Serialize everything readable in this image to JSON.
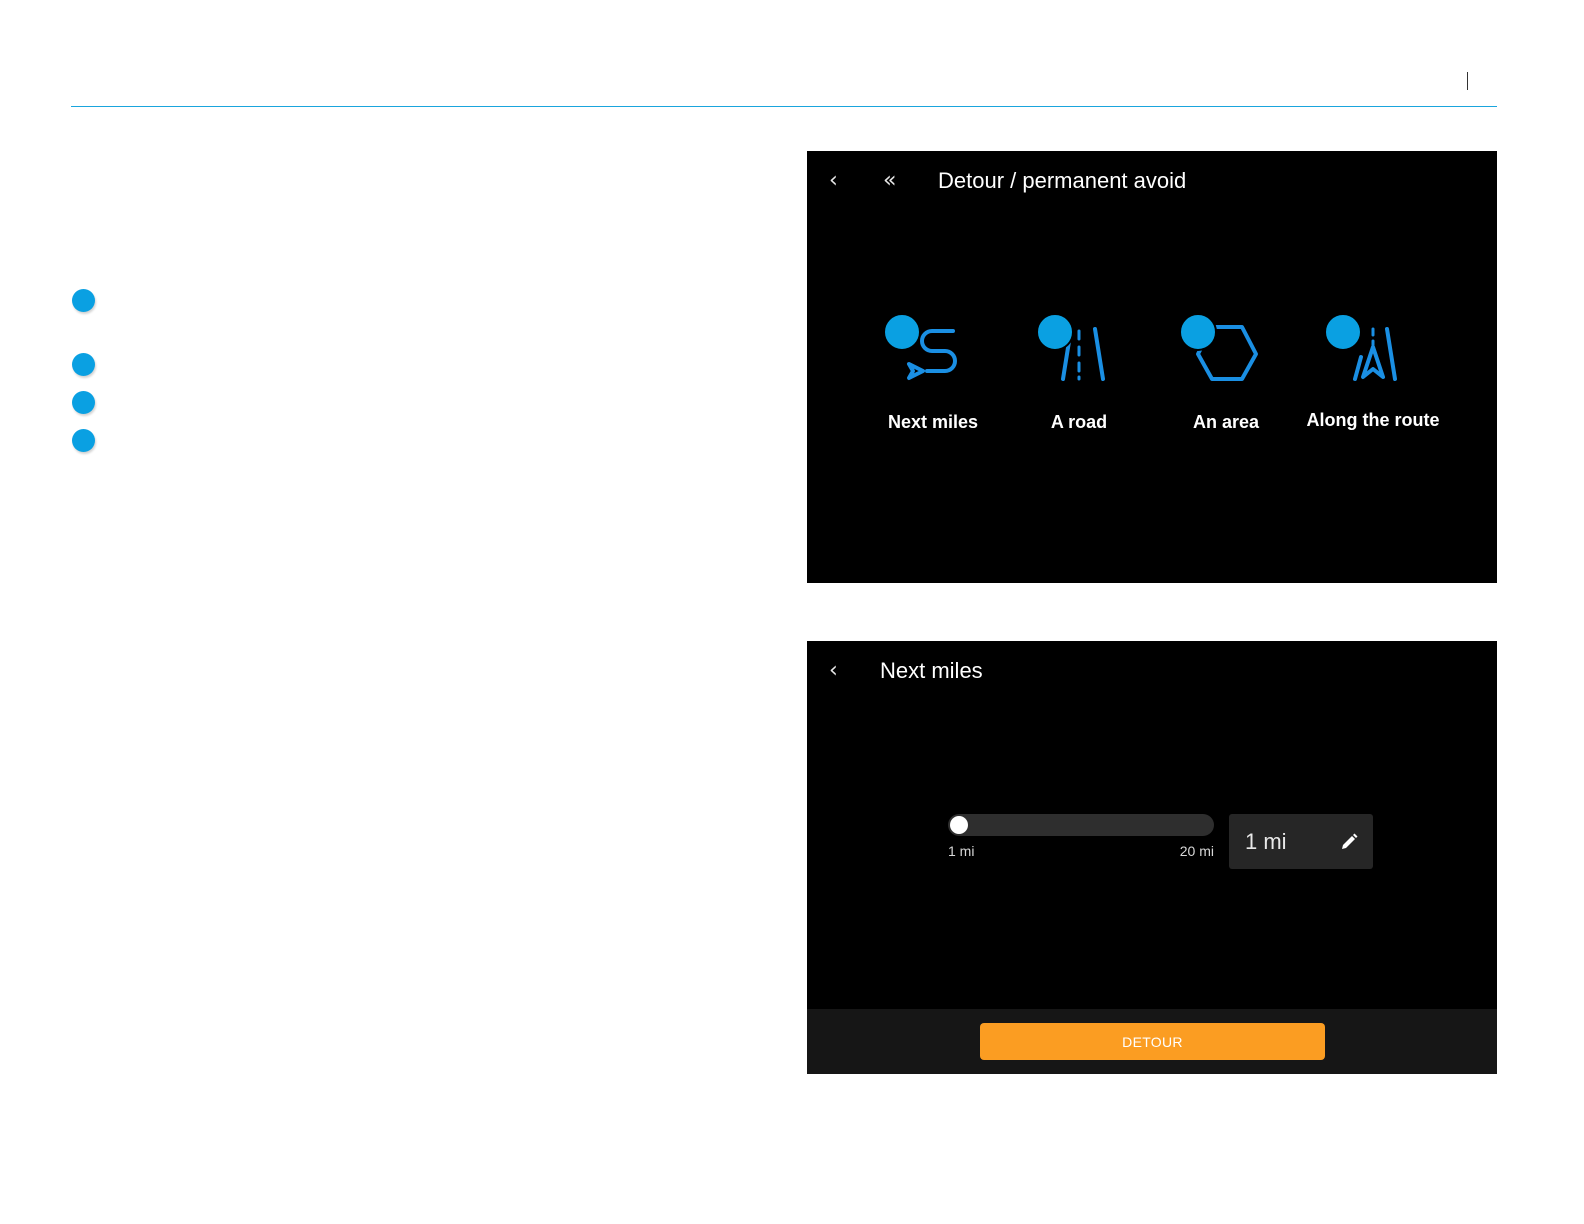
{
  "theme": {
    "accent": "#0aa0e2",
    "header_rule": "#1aa5dd",
    "screen_bg": "#000000",
    "icon_stroke": "#1a8fe3",
    "button_bg": "#fb9d22",
    "field_bg": "#262626",
    "bar_bg": "#161616"
  },
  "bullets": [
    "bullet",
    "bullet",
    "bullet",
    "bullet"
  ],
  "screen1": {
    "back_icon": "back-chevron-icon",
    "home_icon": "double-chevron-icon",
    "title": "Detour / permanent avoid",
    "options": [
      {
        "label": "Next miles",
        "icon": "route-return-icon"
      },
      {
        "label": "A road",
        "icon": "road-lanes-icon"
      },
      {
        "label": "An area",
        "icon": "hexagon-area-icon"
      },
      {
        "label": "Along the route",
        "icon": "route-arrow-icon"
      }
    ]
  },
  "screen2": {
    "back_icon": "back-chevron-icon",
    "title": "Next miles",
    "slider": {
      "min_label": "1 mi",
      "max_label": "20 mi",
      "min": 1,
      "max": 20,
      "value": 1
    },
    "value_field": {
      "value": "1 mi",
      "icon": "pencil-icon"
    },
    "action_button": "DETOUR"
  }
}
